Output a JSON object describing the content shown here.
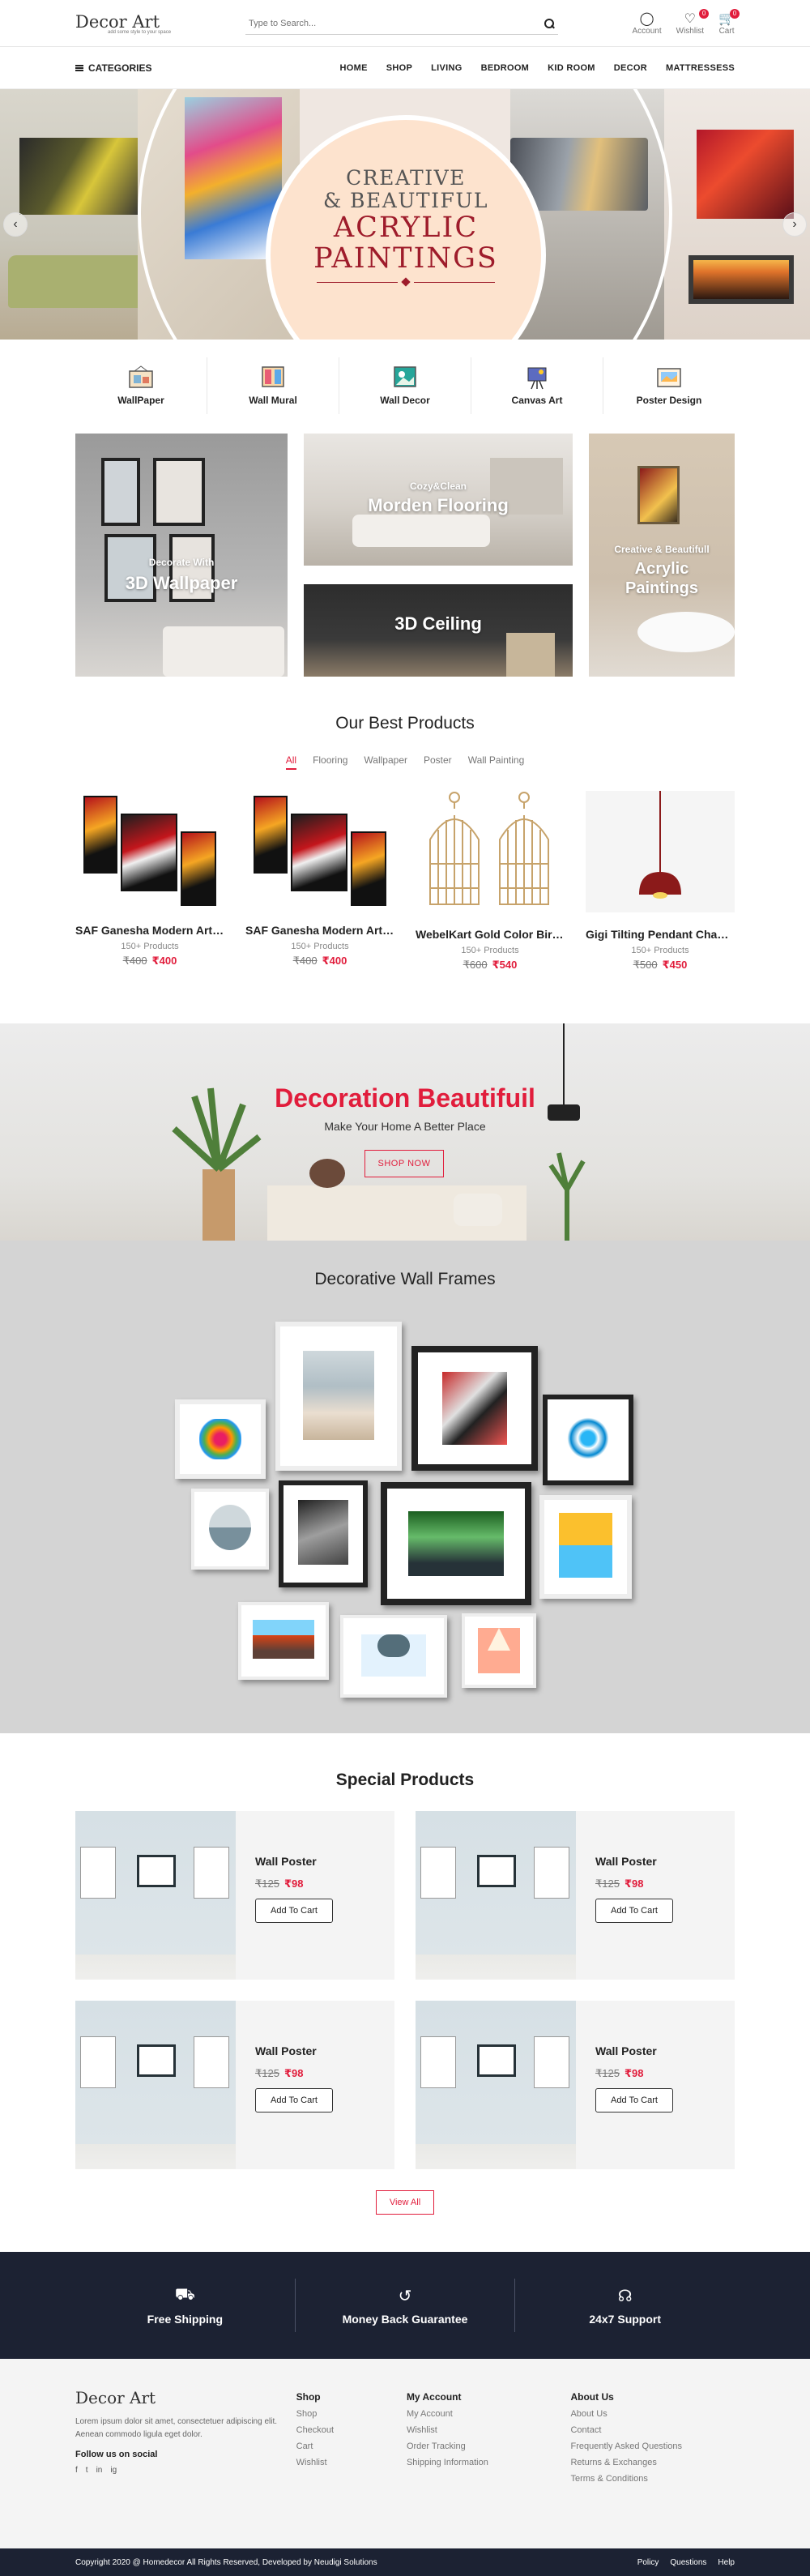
{
  "header": {
    "logo": "Decor Art",
    "tagline": "add some style to your space",
    "search_placeholder": "Type to Search...",
    "account_label": "Account",
    "wishlist_label": "Wishlist",
    "wishlist_count": "0",
    "cart_label": "Cart",
    "cart_count": "0"
  },
  "nav": {
    "categories_label": "CATEGORIES",
    "menu": [
      "HOME",
      "SHOP",
      "LIVING",
      "BEDROOM",
      "KID ROOM",
      "DECOR",
      "MATTRESSESS"
    ]
  },
  "hero": {
    "line1": "CREATIVE",
    "line2": "& BEAUTIFUL",
    "line3": "ACRYLIC",
    "line4": "PAINTINGS",
    "prev": "‹",
    "next": "›"
  },
  "categories": [
    "WallPaper",
    "Wall Mural",
    "Wall Decor",
    "Canvas Art",
    "Poster Design"
  ],
  "banners": {
    "wallpaper_sub": "Decorate With",
    "wallpaper_title": "3D Wallpaper",
    "flooring_sub": "Cozy&Clean",
    "flooring_title": "Morden Flooring",
    "ceiling_title": "3D Ceiling",
    "acrylic_sub": "Creative & Beautifull",
    "acrylic_title_1": "Acrylic",
    "acrylic_title_2": "Paintings"
  },
  "best": {
    "title": "Our Best Products",
    "tabs": [
      "All",
      "Flooring",
      "Wallpaper",
      "Poster",
      "Wall Painting"
    ],
    "products": [
      {
        "name": "SAF Ganesha Modern Art Pai...",
        "sub": "150+ Products",
        "old": "₹400",
        "new": "₹400"
      },
      {
        "name": "SAF Ganesha Modern Art Pai...",
        "sub": "150+ Products",
        "old": "₹400",
        "new": "₹400"
      },
      {
        "name": "WebelKart Gold Color Bird Cage",
        "sub": "150+ Products",
        "old": "₹600",
        "new": "₹540"
      },
      {
        "name": "Gigi Tilting Pendant Chandelier",
        "sub": "150+ Products",
        "old": "₹500",
        "new": "₹450"
      }
    ]
  },
  "decoration": {
    "title": "Decoration Beautifuil",
    "subtitle": "Make Your Home A Better Place",
    "button": "SHOP NOW"
  },
  "frames": {
    "title": "Decorative Wall Frames"
  },
  "special": {
    "title": "Special Products",
    "items": [
      {
        "name": "Wall Poster",
        "old": "₹125",
        "new": "₹98",
        "button": "Add To Cart"
      },
      {
        "name": "Wall Poster",
        "old": "₹125",
        "new": "₹98",
        "button": "Add To Cart"
      },
      {
        "name": "Wall Poster",
        "old": "₹125",
        "new": "₹98",
        "button": "Add To Cart"
      },
      {
        "name": "Wall Poster",
        "old": "₹125",
        "new": "₹98",
        "button": "Add To Cart"
      }
    ],
    "view_all": "View All"
  },
  "features": [
    "Free Shipping",
    "Money Back Guarantee",
    "24x7 Support"
  ],
  "footer": {
    "about_text": "Lorem ipsum dolor sit amet, consectetuer adipiscing elit. Aenean commodo ligula eget dolor.",
    "follow": "Follow us on social",
    "social": [
      "f",
      "t",
      "in",
      "ig"
    ],
    "shop_title": "Shop",
    "shop_links": [
      "Shop",
      "Checkout",
      "Cart",
      "Wishlist"
    ],
    "account_title": "My Account",
    "account_links": [
      "My Account",
      "Wishlist",
      "Order Tracking",
      "Shipping Information"
    ],
    "about_title": "About Us",
    "about_links": [
      "About Us",
      "Contact",
      "Frequently Asked Questions",
      "Returns & Exchanges",
      "Terms & Conditions"
    ]
  },
  "bottom": {
    "copyright": "Copyright 2020 @ Homedecor All Rights Reserved, Developed by Neudigi Solutions",
    "links": [
      "Policy",
      "Questions",
      "Help"
    ]
  },
  "colors": {
    "accent": "#e11d3c",
    "dark": "#1c2233",
    "hero_circle": "#fde3ce",
    "hero_text": "#9e1c2b"
  }
}
